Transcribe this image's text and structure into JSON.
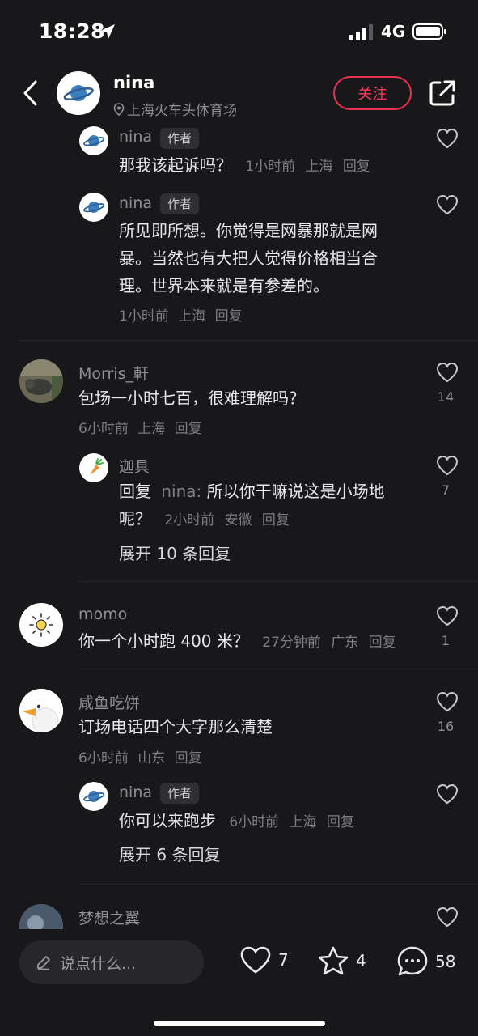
{
  "status_bar": {
    "time": "18:28",
    "network": "4G"
  },
  "header": {
    "username": "nina",
    "location": "上海火车头体育场",
    "follow_label": "关注"
  },
  "author_tag": "作者",
  "reply_word": "回复",
  "comments": [
    {
      "user": "nina",
      "is_author": true,
      "text": "那我该起诉吗？",
      "time": "1小时前",
      "region": "上海",
      "likes": ""
    },
    {
      "user": "nina",
      "is_author": true,
      "text_lines": [
        "所见即所想。你觉得是网暴那就是网",
        "暴。当然也有大把人觉得价格相当合",
        "理。世界本来就是有参差的。"
      ],
      "time": "1小时前",
      "region": "上海",
      "likes": ""
    },
    {
      "user": "Morris_軒",
      "text": "包场一小时七百，很难理解吗？",
      "time": "6小时前",
      "region": "上海",
      "likes": "14",
      "replies": [
        {
          "user": "迦具",
          "reply_to": "nina",
          "text_line1": "所以你干嘛说这是小场地",
          "text_line2": "呢？",
          "time": "2小时前",
          "region": "安徽",
          "likes": "7"
        }
      ],
      "expand_label": "展开 10 条回复"
    },
    {
      "user": "momo",
      "text": "你一个小时跑 400 米？",
      "time": "27分钟前",
      "region": "广东",
      "likes": "1"
    },
    {
      "user": "咸鱼吃饼",
      "text": "订场电话四个大字那么清楚",
      "time": "6小时前",
      "region": "山东",
      "likes": "16",
      "replies": [
        {
          "user": "nina",
          "is_author": true,
          "text": "你可以来跑步",
          "time": "6小时前",
          "region": "上海",
          "likes": ""
        }
      ],
      "expand_label": "展开 6 条回复"
    },
    {
      "user": "梦想之翼"
    }
  ],
  "bottom_bar": {
    "input_placeholder": "说点什么...",
    "likes": "7",
    "favorites": "4",
    "comments": "58"
  }
}
